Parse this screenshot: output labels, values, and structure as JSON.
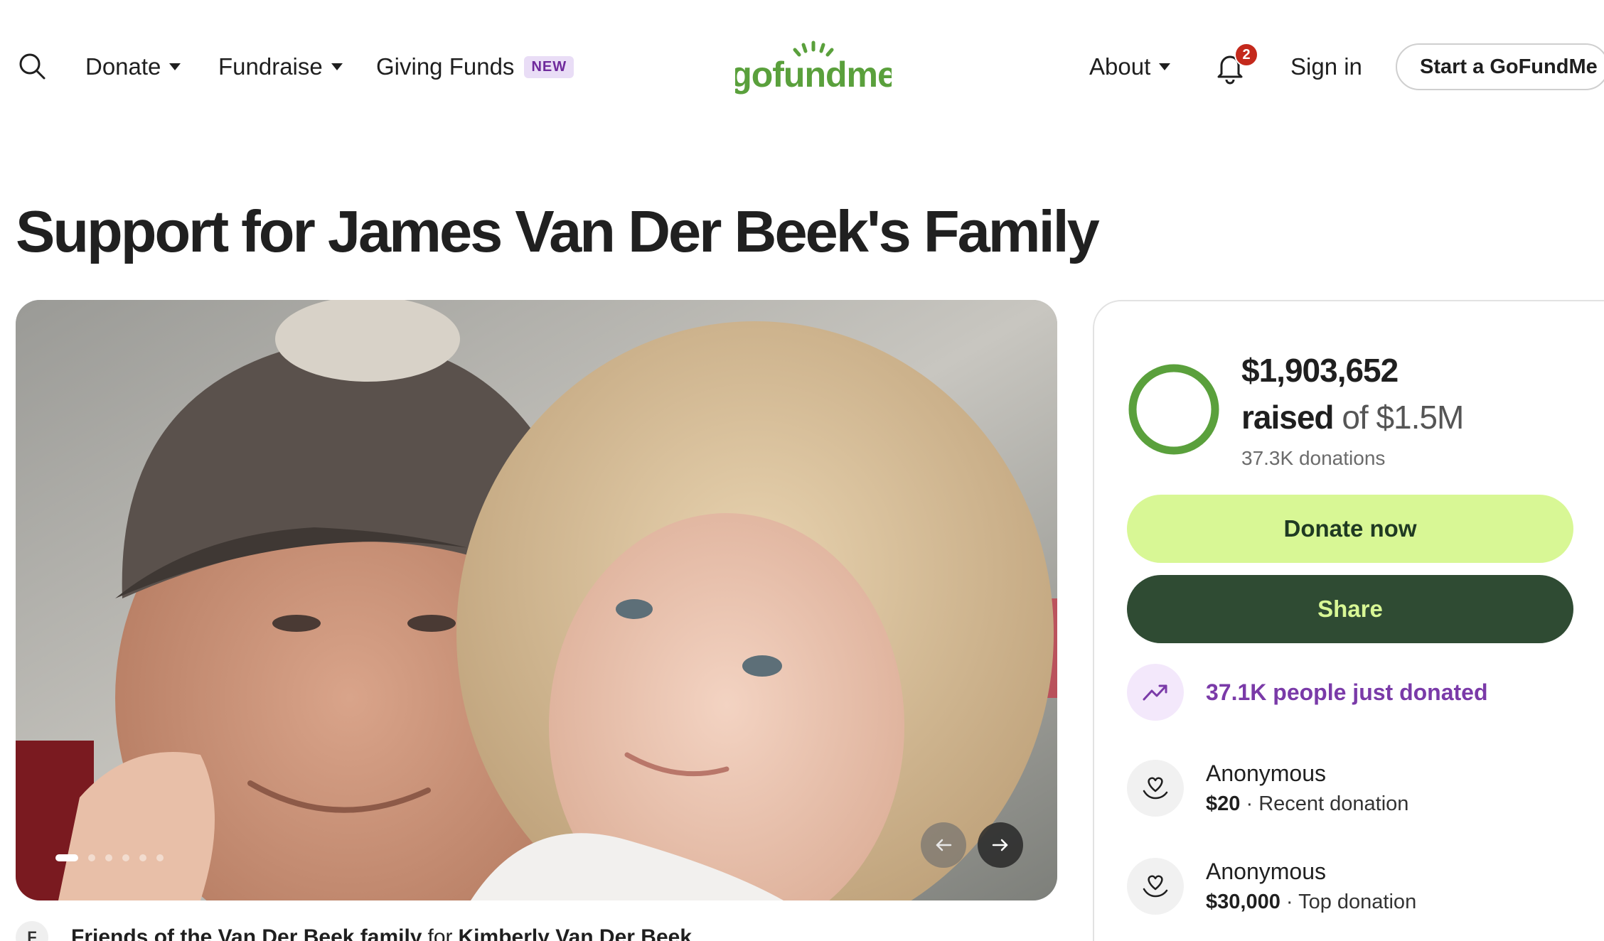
{
  "header": {
    "nav": {
      "donate_label": "Donate",
      "fundraise_label": "Fundraise",
      "giving_funds_label": "Giving Funds",
      "giving_funds_badge": "NEW",
      "about_label": "About",
      "signin_label": "Sign in",
      "start_label": "Start a GoFundMe"
    },
    "logo_text": "gofundme",
    "notification_count": "2",
    "icons": [
      "search-icon",
      "bell-icon",
      "chevron-down-icon"
    ]
  },
  "campaign": {
    "title": "Support for James Van Der Beek's Family",
    "photo_description_icon": "campaign-photo",
    "carousel": {
      "slide_count": 6,
      "active_index": 0
    },
    "organizer": {
      "avatar_initial": "F",
      "name": "Friends of the Van Der Beek family",
      "connector": "for",
      "beneficiary": "Kimberly Van Der Beek"
    }
  },
  "donation_card": {
    "raised_amount": "$1,903,652",
    "raised_word": "raised",
    "goal_text": "of $1.5M",
    "donation_count": "37.3K donations",
    "progress_fraction": 1.0,
    "donate_label": "Donate now",
    "share_label": "Share",
    "trend_text": "37.1K people just donated",
    "donors": [
      {
        "name": "Anonymous",
        "amount": "$20",
        "kind": "Recent donation"
      },
      {
        "name": "Anonymous",
        "amount": "$30,000",
        "kind": "Top donation"
      }
    ],
    "separator": "·"
  },
  "colors": {
    "brand_green": "#5aa03c",
    "donate_button": "#d8f795",
    "share_button": "#2f4b33",
    "trend_purple": "#7a3aa8",
    "notification_red": "#c4291c"
  }
}
